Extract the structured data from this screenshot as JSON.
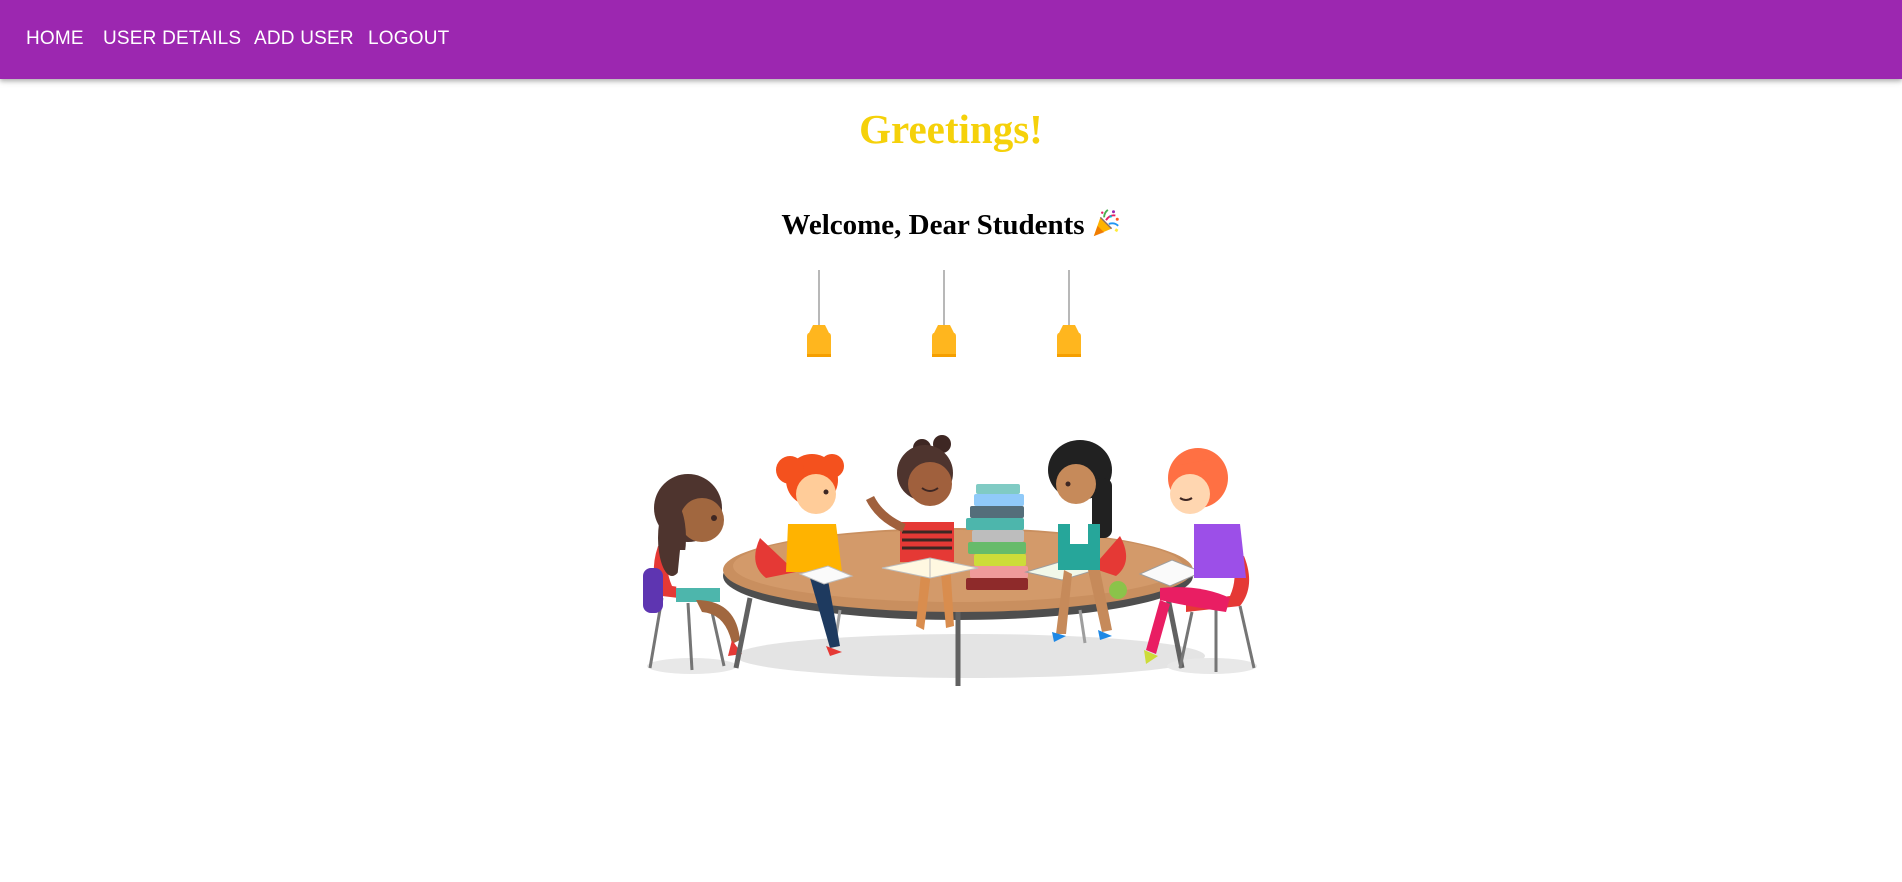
{
  "nav": {
    "items": [
      {
        "label": "HOME"
      },
      {
        "label": "USER DETAILS"
      },
      {
        "label": "ADD USER"
      },
      {
        "label": "LOGOUT"
      }
    ],
    "background": "#9c27b0"
  },
  "main": {
    "title": "Greetings!",
    "title_color": "#f5d10a",
    "subtitle": "Welcome, Dear Students",
    "subtitle_icon": "party-popper-icon",
    "lamp_color": "#ffb61e",
    "illustration": "children-reading-at-round-table"
  }
}
